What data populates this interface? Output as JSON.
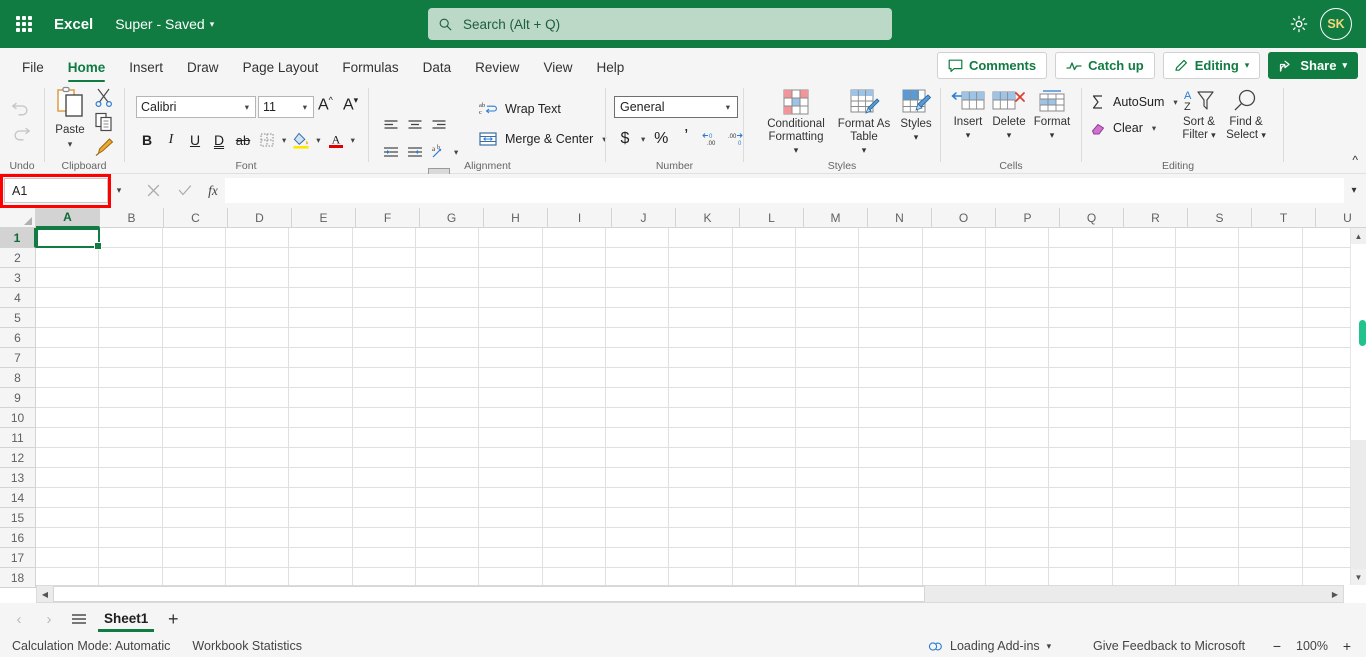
{
  "titlebar": {
    "waffle_label": "app-launcher",
    "app_name": "Excel",
    "doc_title": "Super  -  Saved",
    "search_placeholder": "Search (Alt + Q)",
    "settings_label": "Settings",
    "avatar_initials": "SK"
  },
  "tabs": [
    {
      "label": "File",
      "active": false
    },
    {
      "label": "Home",
      "active": true
    },
    {
      "label": "Insert",
      "active": false
    },
    {
      "label": "Draw",
      "active": false
    },
    {
      "label": "Page Layout",
      "active": false
    },
    {
      "label": "Formulas",
      "active": false
    },
    {
      "label": "Data",
      "active": false
    },
    {
      "label": "Review",
      "active": false
    },
    {
      "label": "View",
      "active": false
    },
    {
      "label": "Help",
      "active": false
    }
  ],
  "tab_actions": {
    "comments": "Comments",
    "catch_up": "Catch up",
    "editing": "Editing",
    "share": "Share"
  },
  "ribbon": {
    "groups": {
      "undo": "Undo",
      "clipboard": "Clipboard",
      "font": "Font",
      "alignment": "Alignment",
      "number": "Number",
      "styles": "Styles",
      "cells": "Cells",
      "editing": "Editing"
    },
    "clipboard": {
      "paste": "Paste",
      "cut": "Cut",
      "copy": "Copy",
      "format_painter": "Format Painter"
    },
    "font": {
      "font_name": "Calibri",
      "font_size": "11",
      "grow": "A",
      "shrink": "A",
      "bold": "B",
      "italic": "I",
      "underline": "U",
      "double_underline": "D",
      "strikethrough": "ab",
      "borders": "Borders",
      "fill_color": "Fill Color",
      "font_color": "Font Color"
    },
    "alignment": {
      "wrap_text": "Wrap Text",
      "merge_center": "Merge & Center"
    },
    "number": {
      "format": "General",
      "accounting": "$",
      "percent": "%",
      "comma": "comma",
      "increase_decimal": "Increase Decimal",
      "decrease_decimal": "Decrease Decimal"
    },
    "styles": {
      "conditional_formatting": "Conditional Formatting",
      "format_as_table": "Format As Table",
      "cell_styles": "Styles"
    },
    "cells": {
      "insert": "Insert",
      "delete": "Delete",
      "format": "Format"
    },
    "editing": {
      "autosum": "AutoSum",
      "clear": "Clear",
      "sort_filter": "Sort & Filter",
      "find_select": "Find & Select"
    },
    "collapse_label": "Collapse Ribbon"
  },
  "formula_bar": {
    "name_box_value": "A1",
    "cancel": "Cancel",
    "enter": "Enter",
    "insert_function": "fx",
    "formula_value": "",
    "expand_label": "Expand formula bar",
    "highlight_color": "#ff0000"
  },
  "grid": {
    "columns": [
      "A",
      "B",
      "C",
      "D",
      "E",
      "F",
      "G",
      "H",
      "I",
      "J",
      "K",
      "L",
      "M",
      "N",
      "O",
      "P",
      "Q",
      "R",
      "S",
      "T",
      "U"
    ],
    "rows": [
      1,
      2,
      3,
      4,
      5,
      6,
      7,
      8,
      9,
      10,
      11,
      12,
      13,
      14,
      15,
      16,
      17,
      18
    ],
    "selected_cell": "A1",
    "selected_column": "A",
    "selected_row": 1,
    "scroll_thumb_color": "#21c28b"
  },
  "sheetbar": {
    "prev": "Previous sheet",
    "next": "Next sheet",
    "all_sheets": "All sheets",
    "sheets": [
      {
        "label": "Sheet1",
        "active": true
      }
    ],
    "add_sheet": "+"
  },
  "statusbar": {
    "calculation_mode": "Calculation Mode: Automatic",
    "workbook_statistics": "Workbook Statistics",
    "addins": "Loading Add-ins",
    "feedback": "Give Feedback to Microsoft",
    "zoom_out": "−",
    "zoom_level": "100%",
    "zoom_in": "+"
  },
  "colors": {
    "brand_green": "#107c41",
    "title_bar": "#107c41",
    "ribbon_bg": "#f5f5f5",
    "accent_selection": "#107c41"
  }
}
